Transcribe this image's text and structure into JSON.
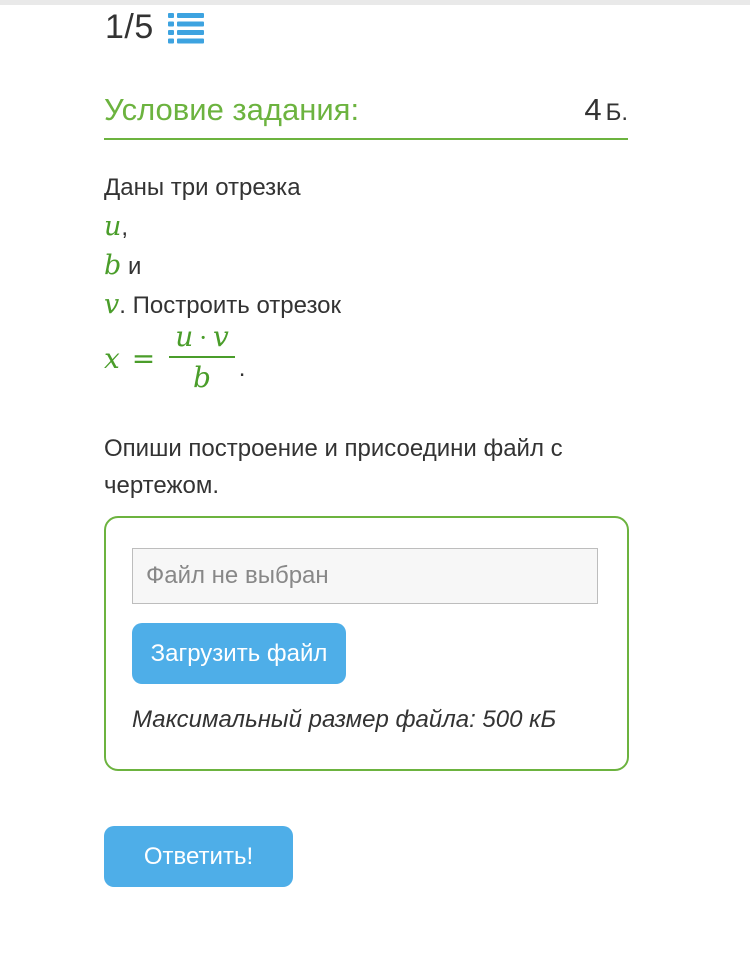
{
  "progress": {
    "counter": "1/5",
    "icon": "list-icon"
  },
  "task": {
    "header_title": "Условие задания:",
    "points_value": "4",
    "points_unit": "Б."
  },
  "statement": {
    "line1": "Даны три отрезка",
    "var_u": "u",
    "comma": ",",
    "var_b": "b",
    "and": "и",
    "var_v": "v",
    "line4_rest": ". Построить отрезок",
    "formula": {
      "lhs": "x",
      "eq": "=",
      "num_a": "u",
      "dot": "·",
      "num_b": "v",
      "den": "b",
      "period": "."
    }
  },
  "instruction": "Опиши построение и присоедини файл с чертежом.",
  "upload": {
    "file_status": "Файл не выбран",
    "button_label": "Загрузить файл",
    "max_size": "Максимальный размер файла: 500 кБ"
  },
  "answer_button": "Ответить!",
  "colors": {
    "accent_green": "#6cb33f",
    "button_blue": "#4eaee8",
    "math_green": "#4a9d2a"
  }
}
